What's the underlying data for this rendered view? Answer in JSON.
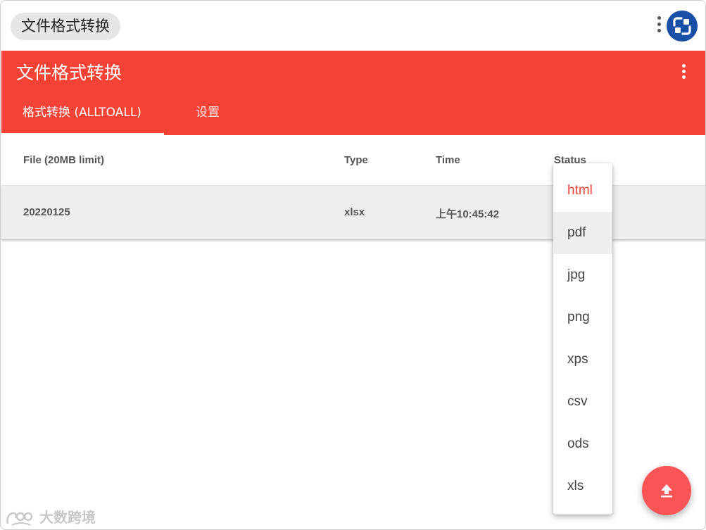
{
  "window": {
    "title": "文件格式转换"
  },
  "appbar": {
    "title": "文件格式转换",
    "tabs": [
      {
        "label": "格式转换 (ALLTOALL)",
        "active": true
      },
      {
        "label": "设置",
        "active": false
      }
    ]
  },
  "table": {
    "headers": [
      "File (20MB limit)",
      "Type",
      "Time",
      "Status"
    ],
    "rows": [
      {
        "file": "20220125",
        "type": "xlsx",
        "time": "上午10:45:42",
        "status": ""
      }
    ]
  },
  "format_menu": {
    "selected": "html",
    "highlighted": "pdf",
    "options": [
      "html",
      "pdf",
      "jpg",
      "png",
      "xps",
      "csv",
      "ods",
      "xls"
    ]
  },
  "fab": {
    "icon": "upload-icon"
  },
  "watermark": {
    "text": "大数跨境"
  },
  "colors": {
    "primary": "#f44336",
    "fab": "#fb5457",
    "logo": "#1a4fa8"
  }
}
